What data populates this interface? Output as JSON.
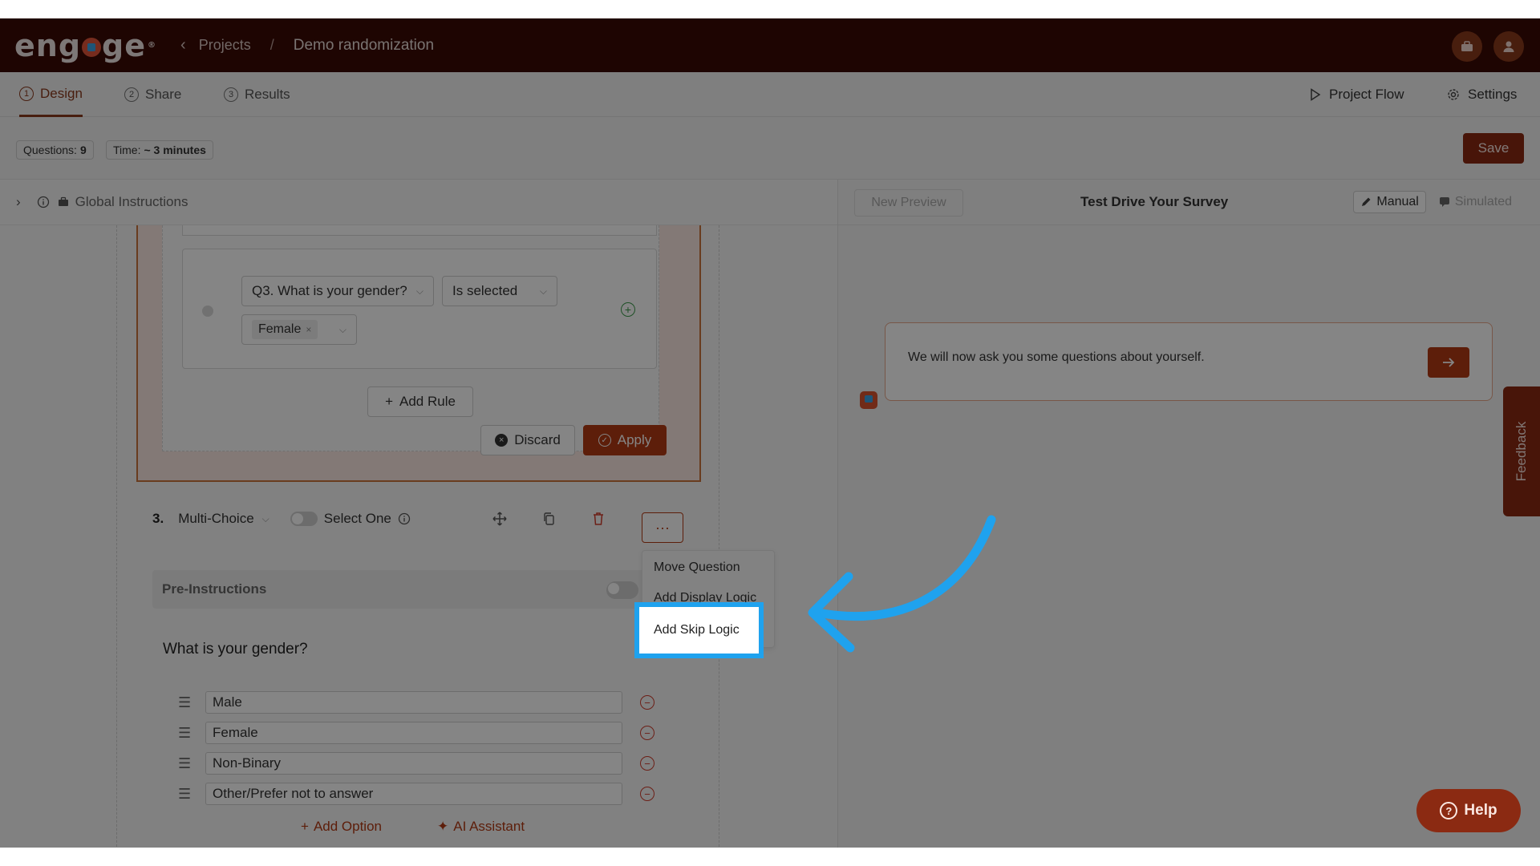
{
  "topbar": {
    "logo": "engage",
    "breadcrumb_projects": "Projects",
    "breadcrumb_sep": "/",
    "breadcrumb_current": "Demo randomization"
  },
  "tabs": [
    {
      "num": "1",
      "label": "Design"
    },
    {
      "num": "2",
      "label": "Share"
    },
    {
      "num": "3",
      "label": "Results"
    }
  ],
  "right_links": {
    "project_flow": "Project Flow",
    "settings": "Settings"
  },
  "stats": {
    "questions_label": "Questions:",
    "questions_value": "9",
    "time_label": "Time:",
    "time_value": "~ 3 minutes"
  },
  "save_label": "Save",
  "global_instructions": "Global Instructions",
  "logic": {
    "question_select": "Q3. What is your gender?",
    "condition_select": "Is selected",
    "value_chip": "Female",
    "add_rule": "Add Rule",
    "discard": "Discard",
    "apply": "Apply"
  },
  "question": {
    "number": "3.",
    "type": "Multi-Choice",
    "select_mode": "Select One",
    "more": "···",
    "pre_instructions": "Pre-Instructions",
    "text": "What is your gender?",
    "options": [
      "Male",
      "Female",
      "Non-Binary",
      "Other/Prefer not to answer"
    ],
    "add_option": "Add Option",
    "ai_assistant": "AI Assistant"
  },
  "menu": {
    "move": "Move Question",
    "display": "Add Display Logic",
    "skip": "Add Skip Logic"
  },
  "preview": {
    "new_preview": "New Preview",
    "title": "Test Drive Your Survey",
    "manual": "Manual",
    "simulated": "Simulated",
    "message": "We will now ask you some questions about yourself."
  },
  "feedback": "Feedback",
  "help": "Help",
  "colors": {
    "brand_dark": "#3a0a04",
    "accent": "#b23a14",
    "highlight": "#1fa2ee"
  }
}
